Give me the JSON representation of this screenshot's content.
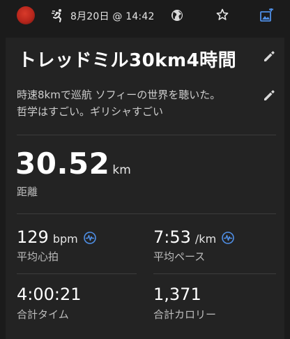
{
  "header": {
    "date": "8月20日 @ 14:42",
    "accent_color": "#4f8fe6",
    "avatar_color": "#c42d20"
  },
  "activity": {
    "title": "トレッドミル30km4時間",
    "description_line1": "時速8kmで巡航 ソフィーの世界を聴いた。",
    "description_line2": "哲学はすごい。ギリシャすごい"
  },
  "distance": {
    "value": "30.52",
    "unit": "km",
    "label": "距離"
  },
  "metrics": {
    "heart_rate": {
      "value": "129",
      "unit": "bpm",
      "label": "平均心拍"
    },
    "pace": {
      "value": "7:53",
      "unit": "/km",
      "label": "平均ペース"
    },
    "total_time": {
      "value": "4:00:21",
      "label": "合計タイム"
    },
    "calories": {
      "value": "1,371",
      "label": "合計カロリー"
    }
  },
  "icons": [
    "runner-icon",
    "globe-icon",
    "star-icon",
    "add-photo-icon",
    "edit-icon",
    "pulse-icon"
  ]
}
